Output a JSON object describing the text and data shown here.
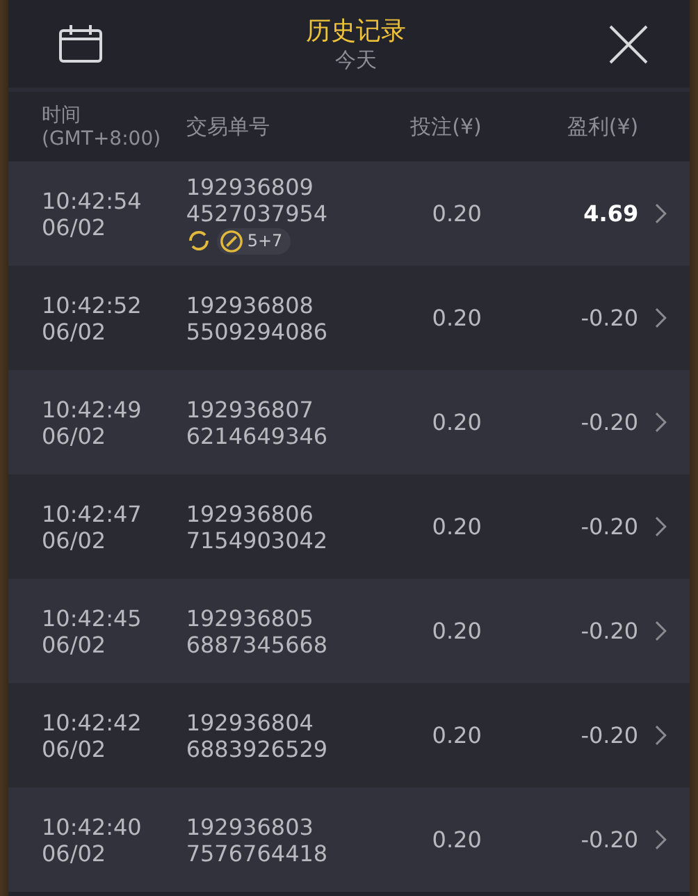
{
  "header": {
    "title": "历史记录",
    "subtitle": "今天"
  },
  "columns": [
    "时间",
    "(GMT+8:00)",
    "交易单号",
    "投注(¥)",
    "盈利(¥)"
  ],
  "rows": [
    {
      "time": "10:42:54",
      "date": "06/02",
      "id_1": "192936809",
      "id_2": "4527037954",
      "bet": "0.20",
      "profit": "4.69",
      "won": true,
      "badge": "5+7"
    },
    {
      "time": "10:42:52",
      "date": "06/02",
      "id_1": "192936808",
      "id_2": "5509294086",
      "bet": "0.20",
      "profit": "-0.20",
      "won": false
    },
    {
      "time": "10:42:49",
      "date": "06/02",
      "id_1": "192936807",
      "id_2": "6214649346",
      "bet": "0.20",
      "profit": "-0.20",
      "won": false
    },
    {
      "time": "10:42:47",
      "date": "06/02",
      "id_1": "192936806",
      "id_2": "7154903042",
      "bet": "0.20",
      "profit": "-0.20",
      "won": false
    },
    {
      "time": "10:42:45",
      "date": "06/02",
      "id_1": "192936805",
      "id_2": "6887345668",
      "bet": "0.20",
      "profit": "-0.20",
      "won": false
    },
    {
      "time": "10:42:42",
      "date": "06/02",
      "id_1": "192936804",
      "id_2": "6883926529",
      "bet": "0.20",
      "profit": "-0.20",
      "won": false
    },
    {
      "time": "10:42:40",
      "date": "06/02",
      "id_1": "192936803",
      "id_2": "7576764418",
      "bet": "0.20",
      "profit": "-0.20",
      "won": false
    }
  ]
}
